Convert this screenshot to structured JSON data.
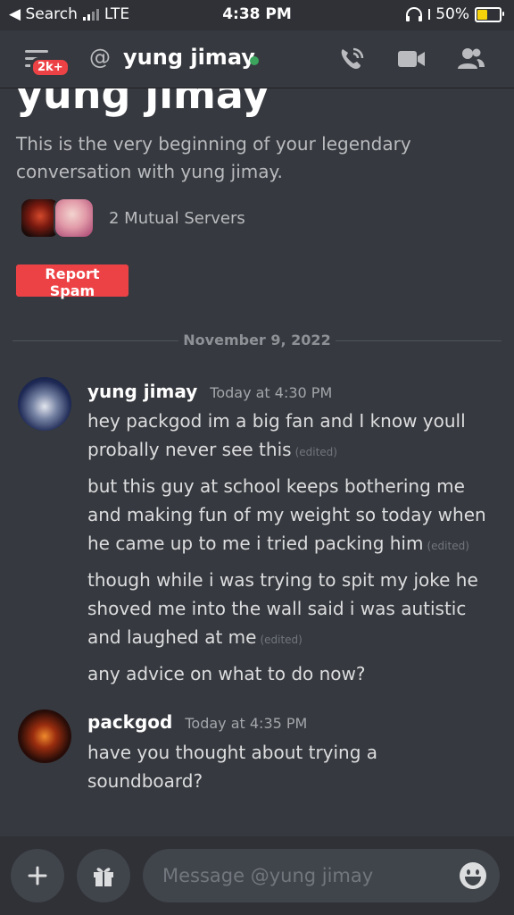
{
  "status_bar": {
    "back_label": "◀ Search",
    "network": "LTE",
    "time": "4:38 PM",
    "battery": "50%",
    "battery_level": 0.5
  },
  "header": {
    "badge": "2k+",
    "at_symbol": "@",
    "title": "yung jimay",
    "status_color": "#3ba55d",
    "icons": [
      "menu-icon",
      "call-icon",
      "video-icon",
      "members-icon"
    ]
  },
  "intro": {
    "name": "yung jimay",
    "text": "This is the very beginning of your legendary conversation with yung jimay.",
    "mutual_servers": "2 Mutual Servers",
    "report_button": "Report Spam"
  },
  "divider_date": "November 9, 2022",
  "messages": [
    {
      "author": "yung jimay",
      "time": "Today at 4:30 PM",
      "lines": [
        {
          "text": "hey packgod im a big fan and I know youll probally never see this",
          "edited": "(edited)"
        },
        {
          "text": "but this guy at school keeps bothering me and making fun of my weight so today when he came up to me i tried packing him",
          "edited": "(edited)"
        },
        {
          "text": "though while i was trying to spit my joke he shoved me into the wall said i was autistic and laughed at me",
          "edited": "(edited)"
        },
        {
          "text": "any advice on what to do now?"
        }
      ]
    },
    {
      "author": "packgod",
      "time": "Today at 4:35 PM",
      "lines": [
        {
          "text": "have you thought about trying a soundboard?"
        }
      ]
    }
  ],
  "composer": {
    "placeholder": "Message @yung jimay",
    "icons": [
      "plus-icon",
      "gift-icon",
      "emoji-icon"
    ]
  },
  "colors": {
    "background": "#36393f",
    "accent_red": "#ed4245",
    "online_green": "#3ba55d"
  }
}
